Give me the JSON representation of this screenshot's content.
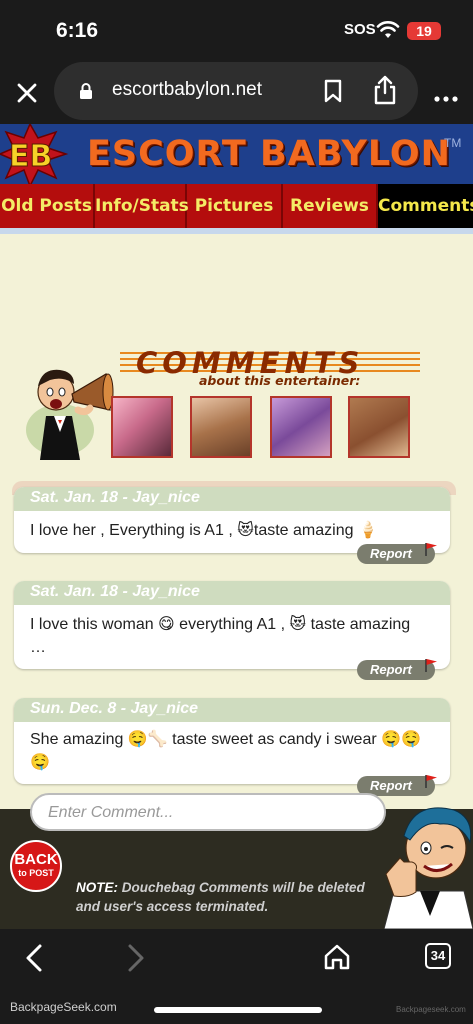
{
  "status_bar": {
    "time": "6:16",
    "sos": "SOS",
    "battery": "19"
  },
  "browser": {
    "url": "escortbabylon.net",
    "tab_count": "34"
  },
  "site": {
    "logo_letters": "EB",
    "title": "ESCORT BABYLON",
    "trademark": "TM",
    "nav": [
      "Old Posts",
      "Info/Stats",
      "Pictures",
      "Reviews",
      "Comments"
    ],
    "comments_heading": "COMMENTS",
    "comments_subheading": "about this entertainer:"
  },
  "comments": [
    {
      "date": "Sat. Jan. 18 - Jay_nice",
      "text": "I love her , Everything is A1 , 😻taste amazing 🍦",
      "report": "Report"
    },
    {
      "date": "Sat. Jan. 18 - Jay_nice",
      "text": "I love this woman 😋 everything A1 , 😻 taste amazing …",
      "report": "Report"
    },
    {
      "date": "Sun. Dec. 8 - Jay_nice",
      "text": "She amazing 🤤🦴 taste sweet as candy i swear 🤤🤤🤤",
      "report": "Report"
    }
  ],
  "footer": {
    "enter_placeholder": "Enter Comment...",
    "back_line1": "BACK",
    "back_line2": "to POST",
    "note_label": "NOTE:",
    "note_text": "Douchebag Comments will be deleted and user's access terminated."
  },
  "watermark": "BackpageSeek.com",
  "watermark_small": "Backpageseek.com",
  "colors": {
    "header_blue": "#1e3f8c",
    "nav_red": "#b40d0d",
    "nav_text": "#f4ec66",
    "title_orange": "#f26a1f",
    "page_bg": "#f3f2d7",
    "comment_header": "#cfdcbf"
  },
  "icons": [
    "close-icon",
    "lock-icon",
    "bookmark-icon",
    "share-icon",
    "more-icon",
    "back-arrow-icon",
    "forward-arrow-icon",
    "home-icon",
    "tabs-icon",
    "flag-icon"
  ]
}
